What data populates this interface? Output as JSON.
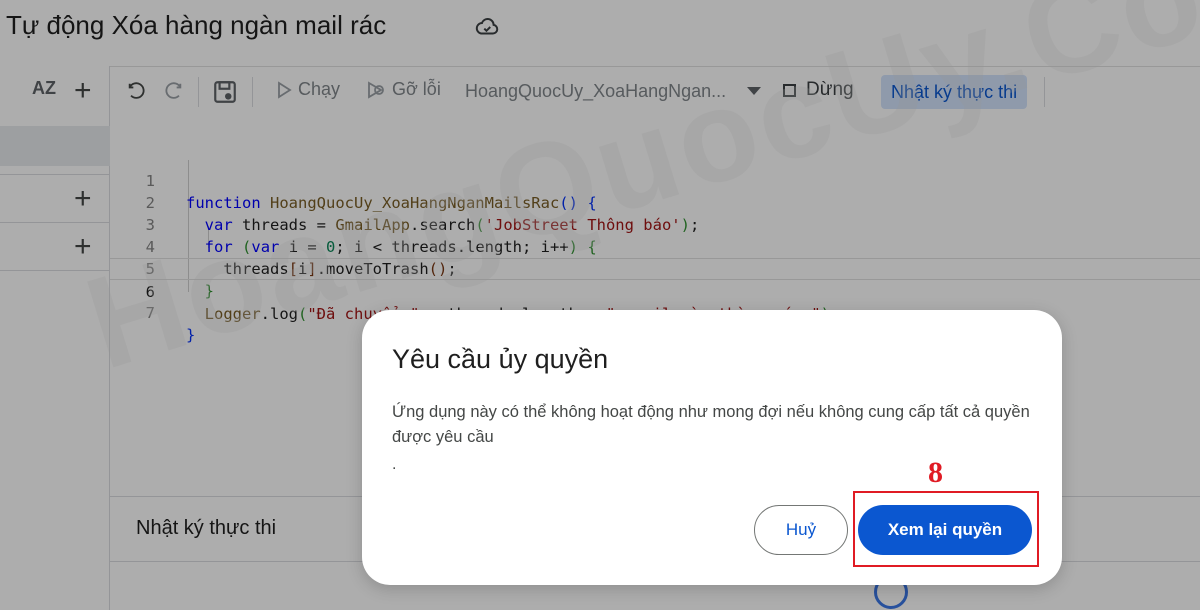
{
  "title": "Tự động Xóa hàng ngàn mail rác",
  "title_icon": "cloud-sync-icon",
  "sidebar": {
    "sort_label": "AZ"
  },
  "toolbar": {
    "undo_icon": "undo-icon",
    "redo_icon": "redo-icon",
    "save_icon": "save-icon",
    "run_label": "Chạy",
    "debug_label": "Gỡ lỗi",
    "function_select": "HoangQuocUy_XoaHangNgan...",
    "stop_label": "Dừng",
    "exec_log_label": "Nhật ký thực thi"
  },
  "editor": {
    "line_numbers": [
      "1",
      "2",
      "3",
      "4",
      "5",
      "6",
      "7"
    ],
    "current_line": "6"
  },
  "bottom_panel": {
    "header": "Nhật ký thực thi"
  },
  "watermark": "HoangQuocUy.Com",
  "dialog": {
    "title": "Yêu cầu ủy quyền",
    "body": "Ứng dụng này có thể không hoạt động như mong đợi nếu không cung cấp tất cả quyền được yêu cầu",
    "trailing": ".",
    "cancel_label": "Huỷ",
    "review_label": "Xem lại quyền"
  },
  "annotation": {
    "step_number": "8",
    "color": "#e01b24"
  },
  "colors": {
    "primary": "#0b57d0",
    "primary_container": "#d3e3fd"
  }
}
